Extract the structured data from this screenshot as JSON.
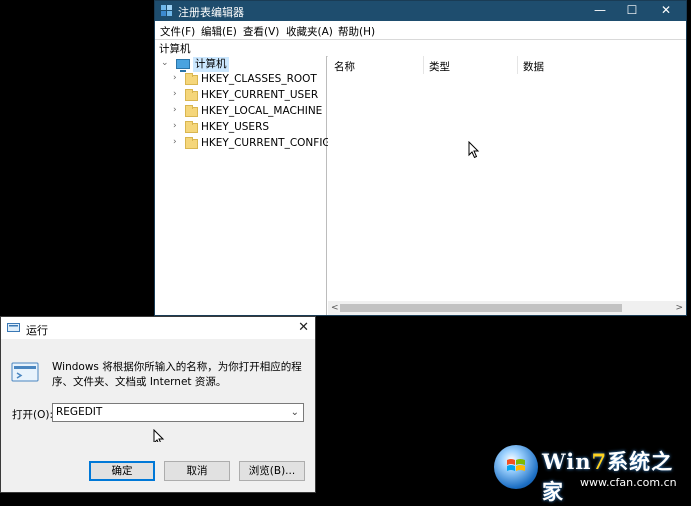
{
  "regedit": {
    "title": "注册表编辑器",
    "window_controls": {
      "minimize": "—",
      "maximize": "☐",
      "close": "✕"
    },
    "menu": [
      "文件(F)",
      "编辑(E)",
      "查看(V)",
      "收藏夹(A)",
      "帮助(H)"
    ],
    "address": "计算机",
    "tree": {
      "root": "计算机",
      "keys": [
        "HKEY_CLASSES_ROOT",
        "HKEY_CURRENT_USER",
        "HKEY_LOCAL_MACHINE",
        "HKEY_USERS",
        "HKEY_CURRENT_CONFIG"
      ]
    },
    "columns": [
      "名称",
      "类型",
      "数据"
    ],
    "scroll_left": "<",
    "scroll_right": ">"
  },
  "run_dialog": {
    "title": "运行",
    "close": "✕",
    "description": "Windows 将根据你所输入的名称，为你打开相应的程序、文件夹、文档或 Internet 资源。",
    "open_label": "打开(O):",
    "input_value": "REGEDIT",
    "dropdown_arrow": "⌄",
    "buttons": {
      "ok": "确定",
      "cancel": "取消",
      "browse": "浏览(B)..."
    }
  },
  "watermark": {
    "brand_prefix": "Win",
    "brand_seven": "7",
    "brand_suffix": "系统之家",
    "url": "www.cfan.com.cn"
  },
  "colors": {
    "titlebar": "#1e4d6e",
    "accent": "#0078d7",
    "selection": "#cce8ff",
    "folder": "#f5d67a"
  }
}
